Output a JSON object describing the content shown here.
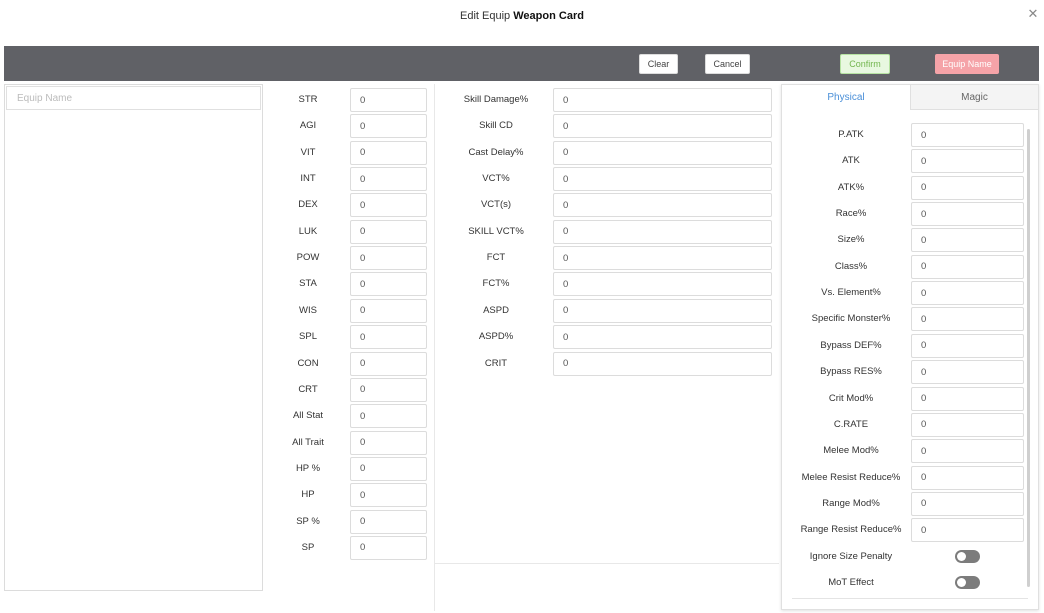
{
  "dialog": {
    "title_prefix": "Edit Equip",
    "title_bold": "Weapon Card"
  },
  "toolbar": {
    "clear_label": "Clear",
    "cancel_label": "Cancel",
    "confirm_label": "Confirm",
    "equip_name_label": "Equip Name",
    "colors": {
      "toolbar_bg": "#606166",
      "confirm_bg": "#e8f8e0",
      "confirm_text": "#73b64f",
      "equip_name_bg": "#f5a3a8"
    }
  },
  "equip_name": {
    "placeholder": "Equip Name",
    "value": ""
  },
  "stats": [
    {
      "label": "STR",
      "value": "0"
    },
    {
      "label": "AGI",
      "value": "0"
    },
    {
      "label": "VIT",
      "value": "0"
    },
    {
      "label": "INT",
      "value": "0"
    },
    {
      "label": "DEX",
      "value": "0"
    },
    {
      "label": "LUK",
      "value": "0"
    },
    {
      "label": "POW",
      "value": "0"
    },
    {
      "label": "STA",
      "value": "0"
    },
    {
      "label": "WIS",
      "value": "0"
    },
    {
      "label": "SPL",
      "value": "0"
    },
    {
      "label": "CON",
      "value": "0"
    },
    {
      "label": "CRT",
      "value": "0"
    },
    {
      "label": "All Stat",
      "value": "0"
    },
    {
      "label": "All Trait",
      "value": "0"
    },
    {
      "label": "HP %",
      "value": "0"
    },
    {
      "label": "HP",
      "value": "0"
    },
    {
      "label": "SP %",
      "value": "0"
    },
    {
      "label": "SP",
      "value": "0"
    }
  ],
  "skills": [
    {
      "label": "Skill Damage%",
      "value": "0"
    },
    {
      "label": "Skill CD",
      "value": "0"
    },
    {
      "label": "Cast Delay%",
      "value": "0"
    },
    {
      "label": "VCT%",
      "value": "0"
    },
    {
      "label": "VCT(s)",
      "value": "0"
    },
    {
      "label": "SKILL VCT%",
      "value": "0"
    },
    {
      "label": "FCT",
      "value": "0"
    },
    {
      "label": "FCT%",
      "value": "0"
    },
    {
      "label": "ASPD",
      "value": "0"
    },
    {
      "label": "ASPD%",
      "value": "0"
    },
    {
      "label": "CRIT",
      "value": "0"
    }
  ],
  "tabs": {
    "physical_label": "Physical",
    "magic_label": "Magic",
    "active": "Physical"
  },
  "physical": [
    {
      "label": "P.ATK",
      "value": "0"
    },
    {
      "label": "ATK",
      "value": "0"
    },
    {
      "label": "ATK%",
      "value": "0"
    },
    {
      "label": "Race%",
      "value": "0"
    },
    {
      "label": "Size%",
      "value": "0"
    },
    {
      "label": "Class%",
      "value": "0"
    },
    {
      "label": "Vs. Element%",
      "value": "0"
    },
    {
      "label": "Specific Monster%",
      "value": "0"
    },
    {
      "label": "Bypass DEF%",
      "value": "0"
    },
    {
      "label": "Bypass RES%",
      "value": "0"
    },
    {
      "label": "Crit Mod%",
      "value": "0"
    },
    {
      "label": "C.RATE",
      "value": "0"
    },
    {
      "label": "Melee Mod%",
      "value": "0"
    },
    {
      "label": "Melee Resist Reduce%",
      "value": "0"
    },
    {
      "label": "Range Mod%",
      "value": "0"
    },
    {
      "label": "Range Resist Reduce%",
      "value": "0"
    }
  ],
  "toggles": [
    {
      "label": "Ignore Size Penalty",
      "on": false
    },
    {
      "label": "MoT Effect",
      "on": false
    }
  ]
}
